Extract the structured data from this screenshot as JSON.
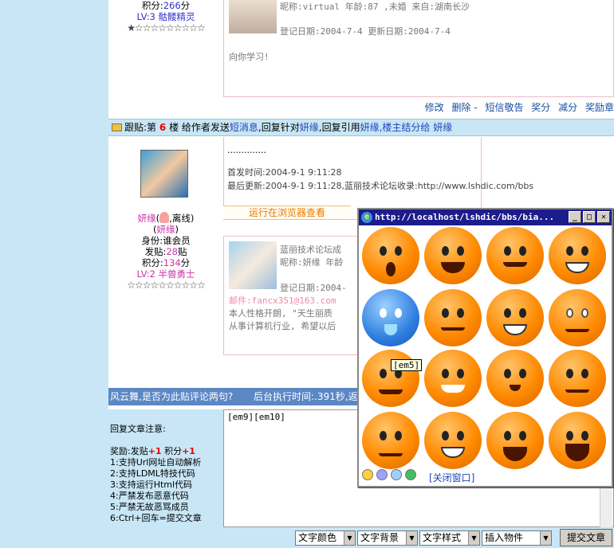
{
  "prev_user": {
    "score_label": "积分",
    "score_value": "266",
    "score_unit": "分",
    "level": "LV:3 骷髅精灵",
    "stars": "★☆☆☆☆☆☆☆☆☆"
  },
  "prev_profile": {
    "line1": "昵称:virtual 年龄:87 ,未婚 来自:湖南长沙",
    "line2": "登记日期:2004-7-4 更新日期:2004-7-4",
    "sign": "向你学习!"
  },
  "actions": [
    "修改",
    "删除",
    "短信敬告",
    "奖分",
    "减分",
    "奖励章"
  ],
  "floor": {
    "prefix": "跟贴:第",
    "number": "6",
    "suffix": "楼 给作者发送",
    "sms": "短消息",
    "reply_to": ",回复针对",
    "user1": "妍缘",
    "quote": ",回复引用",
    "user2": "妍缘",
    "settle": ",楼主结分给",
    "user3": "妍缘"
  },
  "user": {
    "name": "妍缘",
    "status": "离线",
    "alias": "妍缘",
    "identity_label": "身份:",
    "identity": "谁会员",
    "posts_label": "发贴:",
    "posts": "28",
    "posts_unit": "贴",
    "score_label": "积分:",
    "score": "134",
    "score_unit": "分",
    "level": "LV:2 半兽勇士",
    "stars": "☆☆☆☆☆☆☆☆☆☆"
  },
  "message": {
    "dots": "..............",
    "post_time": "首发时间:2004-9-1 9:11:28",
    "update": "最后更新:2004-9-1 9:11:28,蓝丽技术论坛收录:http://www.lshdic.com/bbs",
    "run_button": "运行在浏览器查看"
  },
  "profile": {
    "line0": "蓝丽技术论坛成",
    "line1": "昵称:妍缘 年龄",
    "line2": "登记日期:2004-",
    "email": "邮件:fancx351@163.com",
    "bio1": "本人性格开朗, \"天生丽质",
    "bio2": "从事计算机行业, 希望以后"
  },
  "navbar": {
    "text": "风云舞,是否为此贴评论两句?",
    "exec": "后台执行时间:.391秒,返"
  },
  "reply": {
    "title": "回复文章注意:",
    "reward": "奖励:发贴",
    "reward_plus": "+1",
    "reward_score": "积分",
    "reward_score_plus": "+1",
    "rules": [
      "1:支持Url网址自动解析",
      "2:支持LDML特技代码",
      "3:支持运行Html代码",
      "4:严禁发布恶意代码",
      "5:严禁无故恶骂成员",
      "6:Ctrl+回车=提交文章"
    ],
    "content": "[em9][em10]"
  },
  "toolbar": {
    "font_color": "文字颜色",
    "font_bg": "文字背景",
    "font_style": "文字样式",
    "insert": "插入物件",
    "submit": "提交文章"
  },
  "popup": {
    "title": "http://localhost/lshdic/bbs/bia...",
    "tooltip": "[em5]",
    "close": "[关闭窗口]"
  }
}
